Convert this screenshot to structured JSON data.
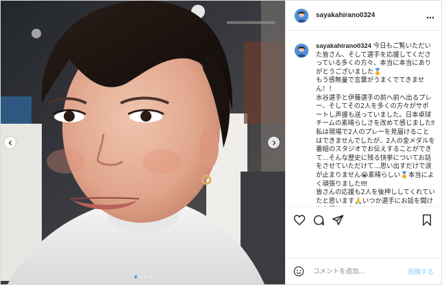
{
  "post": {
    "username": "sayakahirano0324",
    "more_icon": "…",
    "caption_user": "sayakahirano0324",
    "caption_text": "今日もご覧いただいた皆さん、そして選手を応援してくださっている多くの方々、本当に本当にありがとうございました🏅\nもう感無量で言葉がうまくでてきません！！\n水谷選手と伊藤選手の前へ前へ出るプレー、そしてその2人を多くの方々がサポートし声援も送っていました。日本卓球チームの素晴らしさを改めて感じました‼︎\n私は現場で2人のプレーを見届けることはできませんでしたが、2人の金メダルを番組のスタジオでお伝えすることができて…そんな歴史に残る快挙についてお話をさせていただけて…思い出すだけで涙が止まりません😭素晴らしい🏅本当によく頑張りました‼︎‼︎\n皆さんの応援も2人を後押ししてくれていたと思います🙏いつか選手にお話を聞けたら嬉しいな…",
    "comment_placeholder": "コメントを追加...",
    "post_label": "投稿する",
    "carousel": {
      "total": 4,
      "active_index": 0
    }
  },
  "icons": {
    "heart": "heart-icon",
    "comment": "comment-icon",
    "share": "paper-plane-icon",
    "save": "bookmark-icon",
    "emoji": "emoji-icon",
    "prev": "chevron-left-icon",
    "next": "chevron-right-icon"
  }
}
